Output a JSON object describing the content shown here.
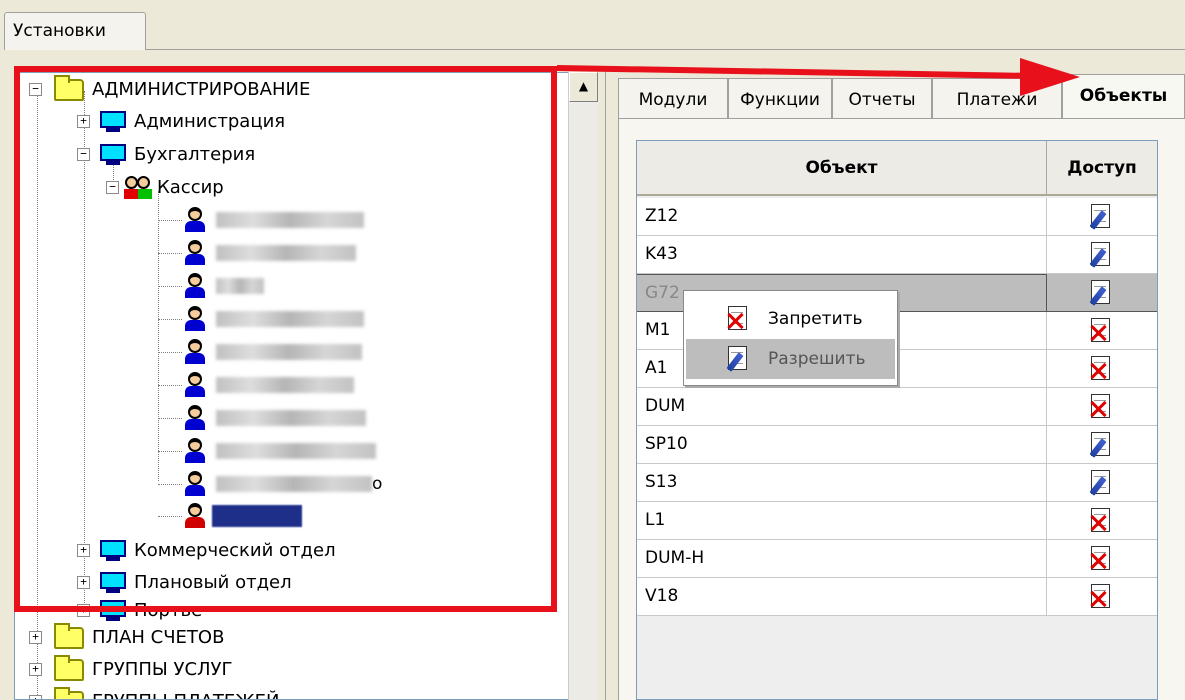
{
  "window": {
    "tab_label": "Установки"
  },
  "tree": {
    "root_label": "АДМИНИСТРИРОВАНИЕ",
    "departments": [
      {
        "label": "Администрация",
        "expanded": false
      },
      {
        "label": "Бухгалтерия",
        "expanded": true
      },
      {
        "label": "Коммерческий отдел",
        "expanded": false
      },
      {
        "label": "Плановый отдел",
        "expanded": false
      },
      {
        "label": "Портье",
        "expanded": false
      }
    ],
    "group_label": "Кассир",
    "hidden_user_suffix": "o",
    "other_roots": [
      "ПЛАН СЧЕТОВ",
      "ГРУППЫ УСЛУГ",
      "ГРУППЫ ПЛАТЕЖЕЙ"
    ]
  },
  "tabs": [
    {
      "label": "Модули",
      "active": false
    },
    {
      "label": "Функции",
      "active": false
    },
    {
      "label": "Отчеты",
      "active": false
    },
    {
      "label": "Платежи",
      "active": false
    },
    {
      "label": "Объекты",
      "active": true
    }
  ],
  "grid": {
    "columns": [
      "Объект",
      "Доступ"
    ],
    "rows": [
      {
        "object": "Z12",
        "access": "allow-icon"
      },
      {
        "object": "K43",
        "access": "allow-icon"
      },
      {
        "object": "G72",
        "access": "allow-icon",
        "selected": true
      },
      {
        "object": "M1",
        "access": "deny-icon"
      },
      {
        "object": "A1",
        "access": "deny-icon"
      },
      {
        "object": "DUM",
        "access": "deny-icon"
      },
      {
        "object": "SP10",
        "access": "allow-icon"
      },
      {
        "object": "S13",
        "access": "allow-icon"
      },
      {
        "object": "L1",
        "access": "deny-icon"
      },
      {
        "object": "DUM-H",
        "access": "deny-icon"
      },
      {
        "object": "V18",
        "access": "deny-icon"
      }
    ]
  },
  "context_menu": {
    "items": [
      {
        "label": "Запретить",
        "icon": "deny-icon"
      },
      {
        "label": "Разрешить",
        "icon": "allow-icon",
        "highlighted": true
      }
    ]
  },
  "colors": {
    "annotation_red": "#e8101a",
    "selection_gray": "#bdbdbd"
  }
}
